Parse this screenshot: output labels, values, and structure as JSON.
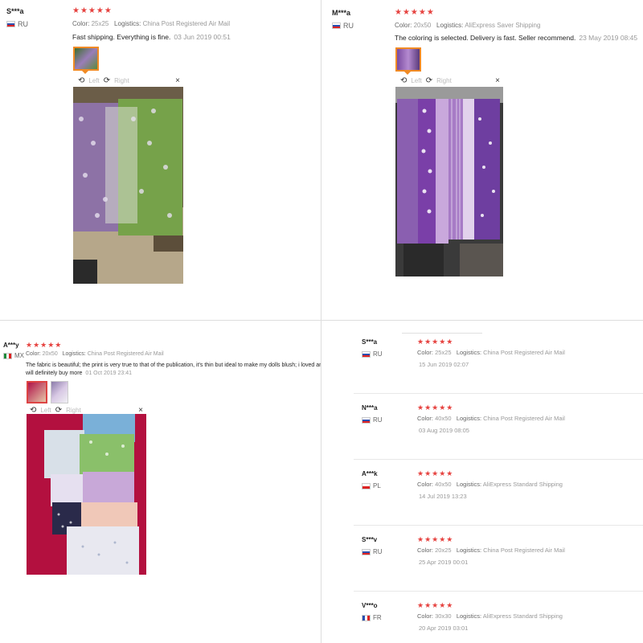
{
  "toolbar": {
    "left": "Left",
    "right": "Right",
    "close": "×",
    "rotate_left": "⟲",
    "rotate_right": "⟳"
  },
  "q1": {
    "user": "S***a",
    "country": "RU",
    "stars": "★★★★★",
    "color_label": "Color:",
    "color": "25x25",
    "logistics_label": "Logistics:",
    "logistics": "China Post Registered Air Mail",
    "review": "Fast shipping. Everything is fine.",
    "date": "03 Jun 2019 00:51"
  },
  "q2": {
    "user": "M***a",
    "country": "RU",
    "stars": "★★★★★",
    "color_label": "Color:",
    "color": "20x50",
    "logistics_label": "Logistics:",
    "logistics": "AliExpress Saver Shipping",
    "review": "The coloring is selected. Delivery is fast. Seller recommend.",
    "date": "23 May 2019 08:45"
  },
  "q3": {
    "user": "A***y",
    "country": "MX",
    "stars": "★★★★★",
    "color_label": "Color:",
    "color": "20x50",
    "logistics_label": "Logistics:",
    "logistics": "China Post Registered Air Mail",
    "review": "The fabric is beautiful; the print is very true to that of the publication, it's thin but ideal to make my dolls blush; i loved and will definitely buy more",
    "date": "01 Oct 2019 23:41"
  },
  "q4": {
    "reviews": [
      {
        "user": "S***a",
        "country": "RU",
        "flag": "flag-ru",
        "stars": "★★★★★",
        "color_label": "Color:",
        "color": "25x25",
        "logistics_label": "Logistics:",
        "logistics": "China Post Registered Air Mail",
        "date": "15 Jun 2019 02:07"
      },
      {
        "user": "N***a",
        "country": "RU",
        "flag": "flag-ru",
        "stars": "★★★★★",
        "color_label": "Color:",
        "color": "40x50",
        "logistics_label": "Logistics:",
        "logistics": "China Post Registered Air Mail",
        "date": "03 Aug 2019 08:05"
      },
      {
        "user": "A***k",
        "country": "PL",
        "flag": "flag-pl",
        "stars": "★★★★★",
        "color_label": "Color:",
        "color": "40x50",
        "logistics_label": "Logistics:",
        "logistics": "AliExpress Standard Shipping",
        "date": "14 Jul 2019 13:23"
      },
      {
        "user": "S***v",
        "country": "RU",
        "flag": "flag-ru",
        "stars": "★★★★★",
        "color_label": "Color:",
        "color": "20x25",
        "logistics_label": "Logistics:",
        "logistics": "China Post Registered Air Mail",
        "date": "25 Apr 2019 00:01"
      },
      {
        "user": "V***o",
        "country": "FR",
        "flag": "flag-fr",
        "stars": "★★★★★",
        "color_label": "Color:",
        "color": "30x30",
        "logistics_label": "Logistics:",
        "logistics": "AliExpress Standard Shipping",
        "date": "20 Apr 2019 03:01"
      }
    ]
  },
  "colors": {
    "star": "#e64340",
    "thumb_active": "#f08a24",
    "divider": "#dddddd"
  }
}
